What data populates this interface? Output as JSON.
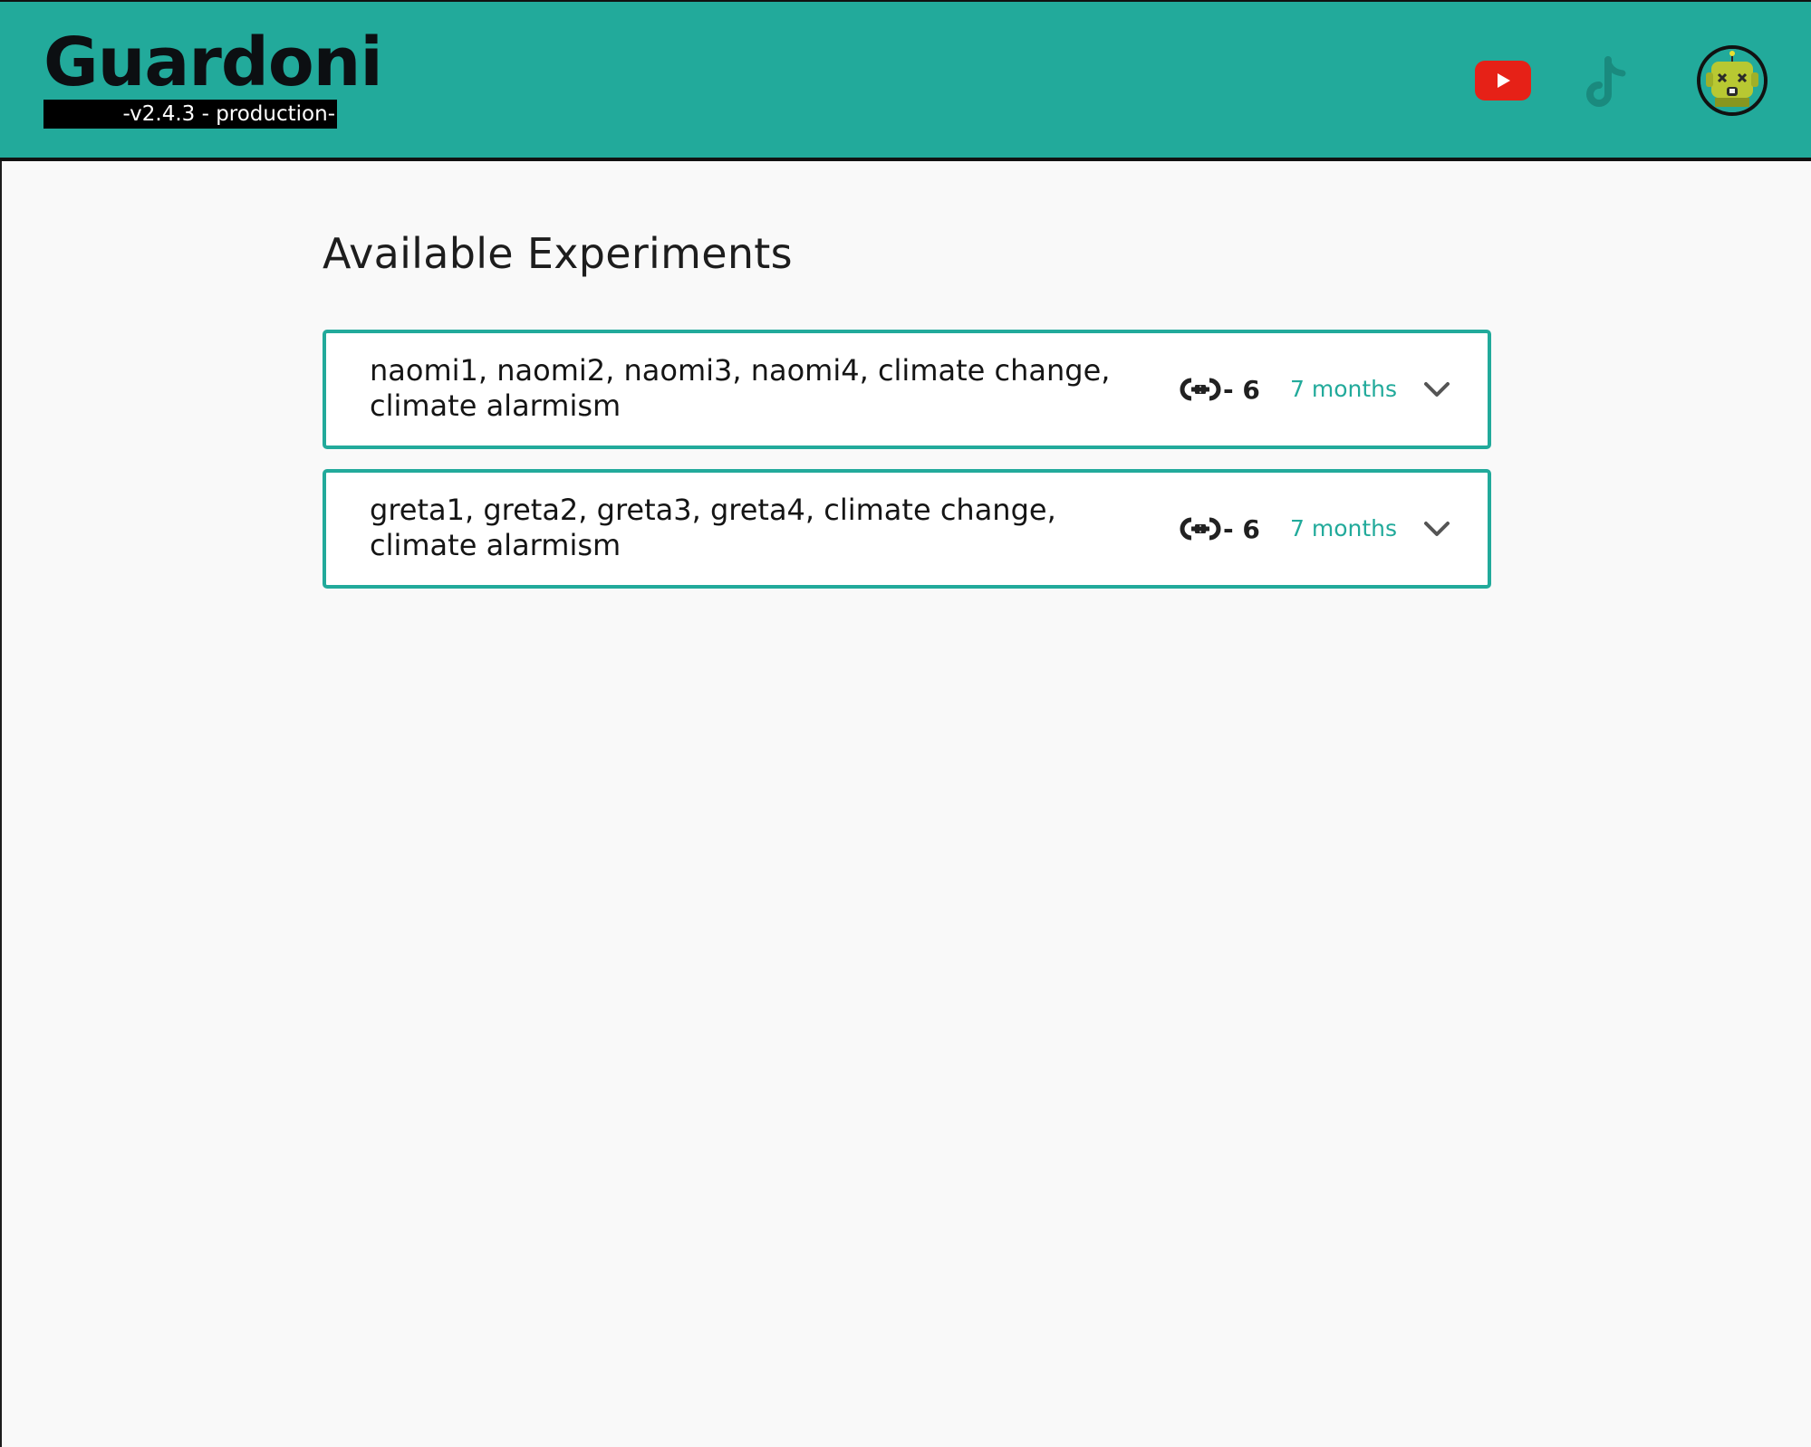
{
  "header": {
    "brand": "Guardoni",
    "version": "-v2.4.3 - production-",
    "icons": [
      "youtube-icon",
      "tiktok-icon",
      "avatar-robot-icon"
    ]
  },
  "main": {
    "title": "Available Experiments",
    "experiments": [
      {
        "tags": "naomi1, naomi2, naomi3, naomi4, climate change, climate alarmism",
        "links_count": "- 6",
        "age": "7 months"
      },
      {
        "tags": "greta1, greta2, greta3, greta4, climate change, climate alarmism",
        "links_count": "- 6",
        "age": "7 months"
      }
    ]
  },
  "colors": {
    "accent": "#22aa9b",
    "youtube_red": "#e62117",
    "background": "#f9f9f9"
  }
}
